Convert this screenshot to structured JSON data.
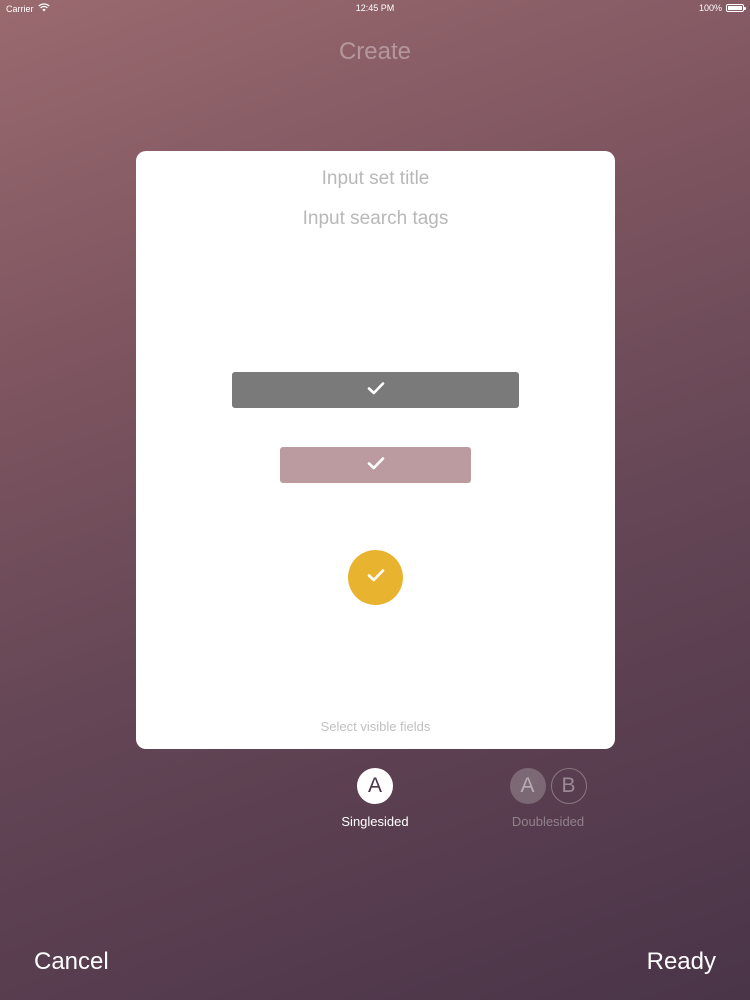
{
  "status_bar": {
    "carrier": "Carrier",
    "time": "12:45 PM",
    "battery": "100%",
    "battery_level": 1.0
  },
  "header": {
    "title": "Create"
  },
  "card": {
    "title_placeholder": "Input set title",
    "tags_placeholder": "Input search tags",
    "fields": [
      {
        "icon": "checkmark-icon",
        "color": "#7a7a7a",
        "selected": true
      },
      {
        "icon": "checkmark-icon",
        "color": "#bb9b9f",
        "selected": true
      },
      {
        "icon": "checkmark-icon",
        "color": "#e8b42f",
        "selected": true
      }
    ],
    "hint": "Select visible fields"
  },
  "modes": {
    "single": {
      "circle_label": "A",
      "label": "Singlesided",
      "selected": true
    },
    "double": {
      "circle_a": "A",
      "circle_b": "B",
      "label": "Doublesided",
      "selected": false
    }
  },
  "footer": {
    "cancel_label": "Cancel",
    "ready_label": "Ready"
  }
}
